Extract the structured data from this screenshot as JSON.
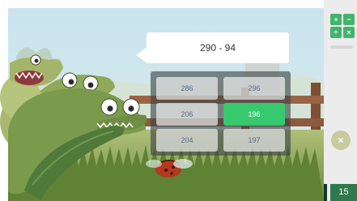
{
  "question": {
    "text": "290 - 94"
  },
  "answers": [
    {
      "label": "286"
    },
    {
      "label": "296"
    },
    {
      "label": "206"
    },
    {
      "label": "196"
    },
    {
      "label": "204"
    },
    {
      "label": "197"
    }
  ],
  "correct_answer": "196",
  "sidebar": {
    "calculator_icon": "calculator-icon",
    "calculator_symbols": [
      "+",
      "−",
      "÷",
      "×"
    ],
    "close_icon": "×",
    "score": "15"
  },
  "colors": {
    "sky": "#cfe7f1",
    "grass": "#7e9a47",
    "correct": "#36c96e",
    "sidebar_green": "#43b56b",
    "score_bg": "#2f7a4d"
  }
}
